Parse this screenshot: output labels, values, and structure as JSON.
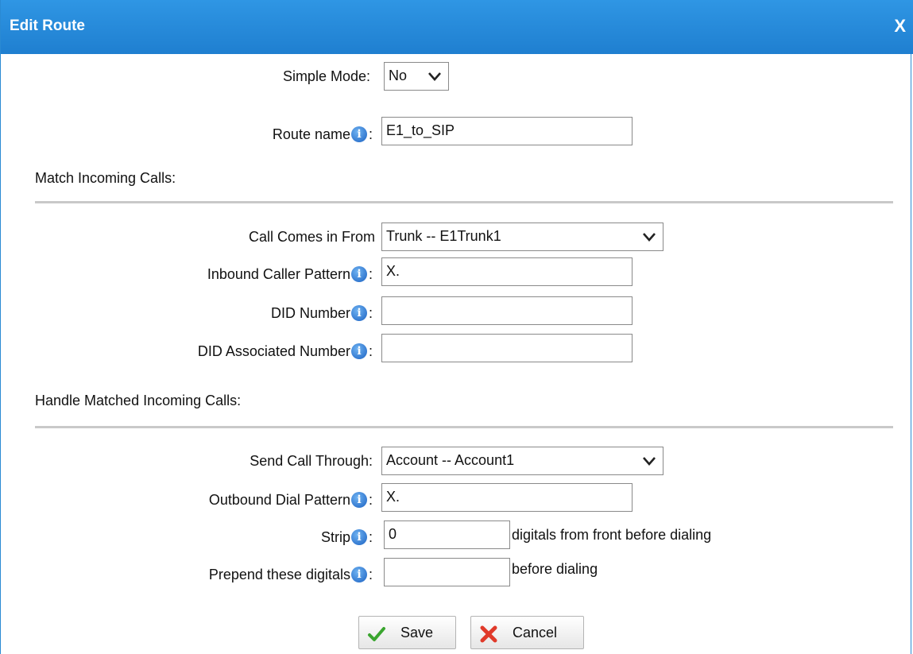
{
  "dialog": {
    "title": "Edit Route",
    "close": "X"
  },
  "simple_mode": {
    "label": "Simple Mode:",
    "value": "No"
  },
  "route_name": {
    "label": "Route name",
    "value": "E1_to_SIP"
  },
  "match_section": {
    "title": "Match Incoming Calls:"
  },
  "call_from": {
    "label": "Call Comes in From",
    "value": "Trunk -- E1Trunk1"
  },
  "inbound_pattern": {
    "label": "Inbound Caller Pattern",
    "value": "X."
  },
  "did_number": {
    "label": "DID Number",
    "value": ""
  },
  "did_assoc": {
    "label": "DID Associated Number",
    "value": ""
  },
  "handle_section": {
    "title": "Handle Matched Incoming Calls:"
  },
  "send_through": {
    "label": "Send Call Through:",
    "value": "Account -- Account1"
  },
  "outbound_pattern": {
    "label": "Outbound Dial Pattern",
    "value": "X."
  },
  "strip": {
    "label": "Strip",
    "value": "0",
    "suffix": "digitals from front before dialing"
  },
  "prepend": {
    "label": "Prepend these digitals",
    "value": "",
    "suffix": "before dialing"
  },
  "buttons": {
    "save": "Save",
    "cancel": "Cancel"
  },
  "colon": ":"
}
